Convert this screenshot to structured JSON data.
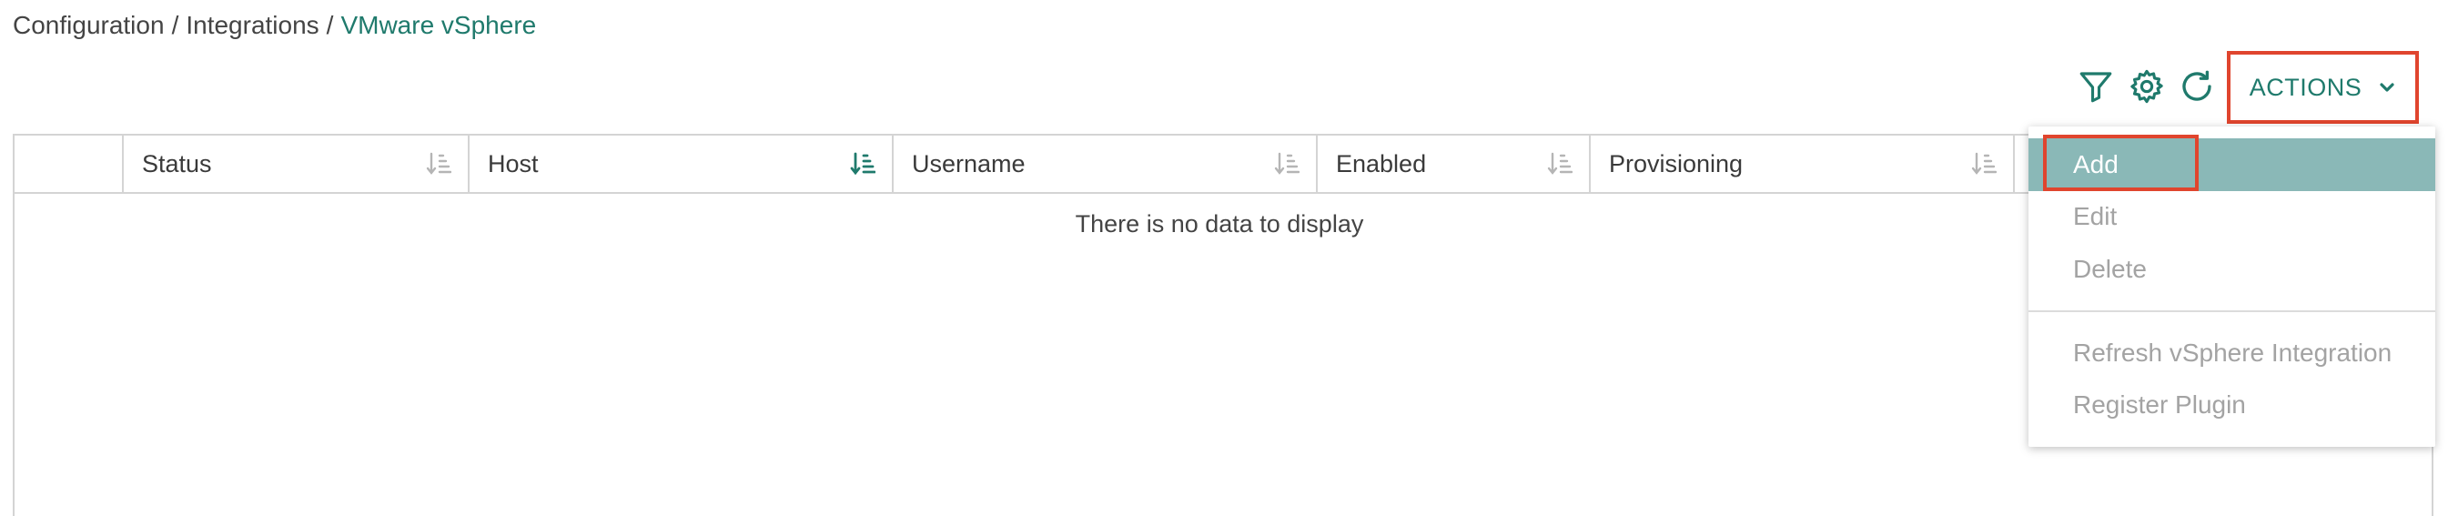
{
  "breadcrumb": {
    "items": [
      "Configuration",
      "Integrations"
    ],
    "separator": "/",
    "current": "VMware vSphere"
  },
  "toolbar": {
    "icons": [
      "filter-icon",
      "settings-gear-icon",
      "refresh-icon"
    ],
    "actions_label": "ACTIONS"
  },
  "grid": {
    "columns": [
      {
        "label": "",
        "sort": "none"
      },
      {
        "label": "Status",
        "sort": "inactive"
      },
      {
        "label": "Host",
        "sort": "active"
      },
      {
        "label": "Username",
        "sort": "inactive"
      },
      {
        "label": "Enabled",
        "sort": "inactive"
      },
      {
        "label": "Provisioning",
        "sort": "inactive"
      },
      {
        "label": "",
        "sort": "none"
      }
    ],
    "empty_message": "There is no data to display"
  },
  "actions_menu": {
    "items": [
      {
        "label": "Add",
        "state": "selected"
      },
      {
        "label": "Edit",
        "state": "disabled"
      },
      {
        "label": "Delete",
        "state": "disabled"
      },
      {
        "label": "Refresh vSphere Integration",
        "state": "disabled"
      },
      {
        "label": "Register Plugin",
        "state": "disabled"
      }
    ]
  },
  "colors": {
    "accent": "#1f7a6c",
    "highlight_border": "#e0452e",
    "menu_selected_bg": "#8ab8b7",
    "disabled_text": "#a3a3a3",
    "border": "#d4d4d4"
  }
}
